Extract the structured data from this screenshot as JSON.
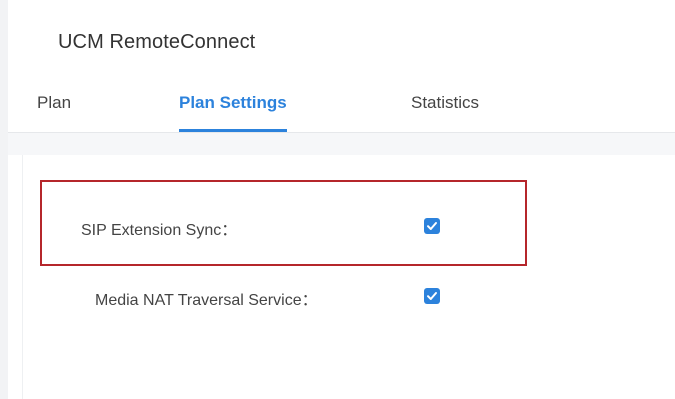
{
  "app": {
    "title": "UCM RemoteConnect"
  },
  "tabs": [
    {
      "label": "Plan",
      "active": false
    },
    {
      "label": "Plan Settings",
      "active": true
    },
    {
      "label": "Statistics",
      "active": false
    }
  ],
  "settings": {
    "sip_extension_sync": {
      "label": "SIP Extension Sync：",
      "checked": true,
      "highlighted": true
    },
    "media_nat_traversal": {
      "label": "Media NAT Traversal Service：",
      "checked": true
    }
  },
  "colors": {
    "accent": "#2c82dc",
    "highlight_border": "#b5262b"
  },
  "icons": {
    "checkbox": "checkmark-icon"
  }
}
